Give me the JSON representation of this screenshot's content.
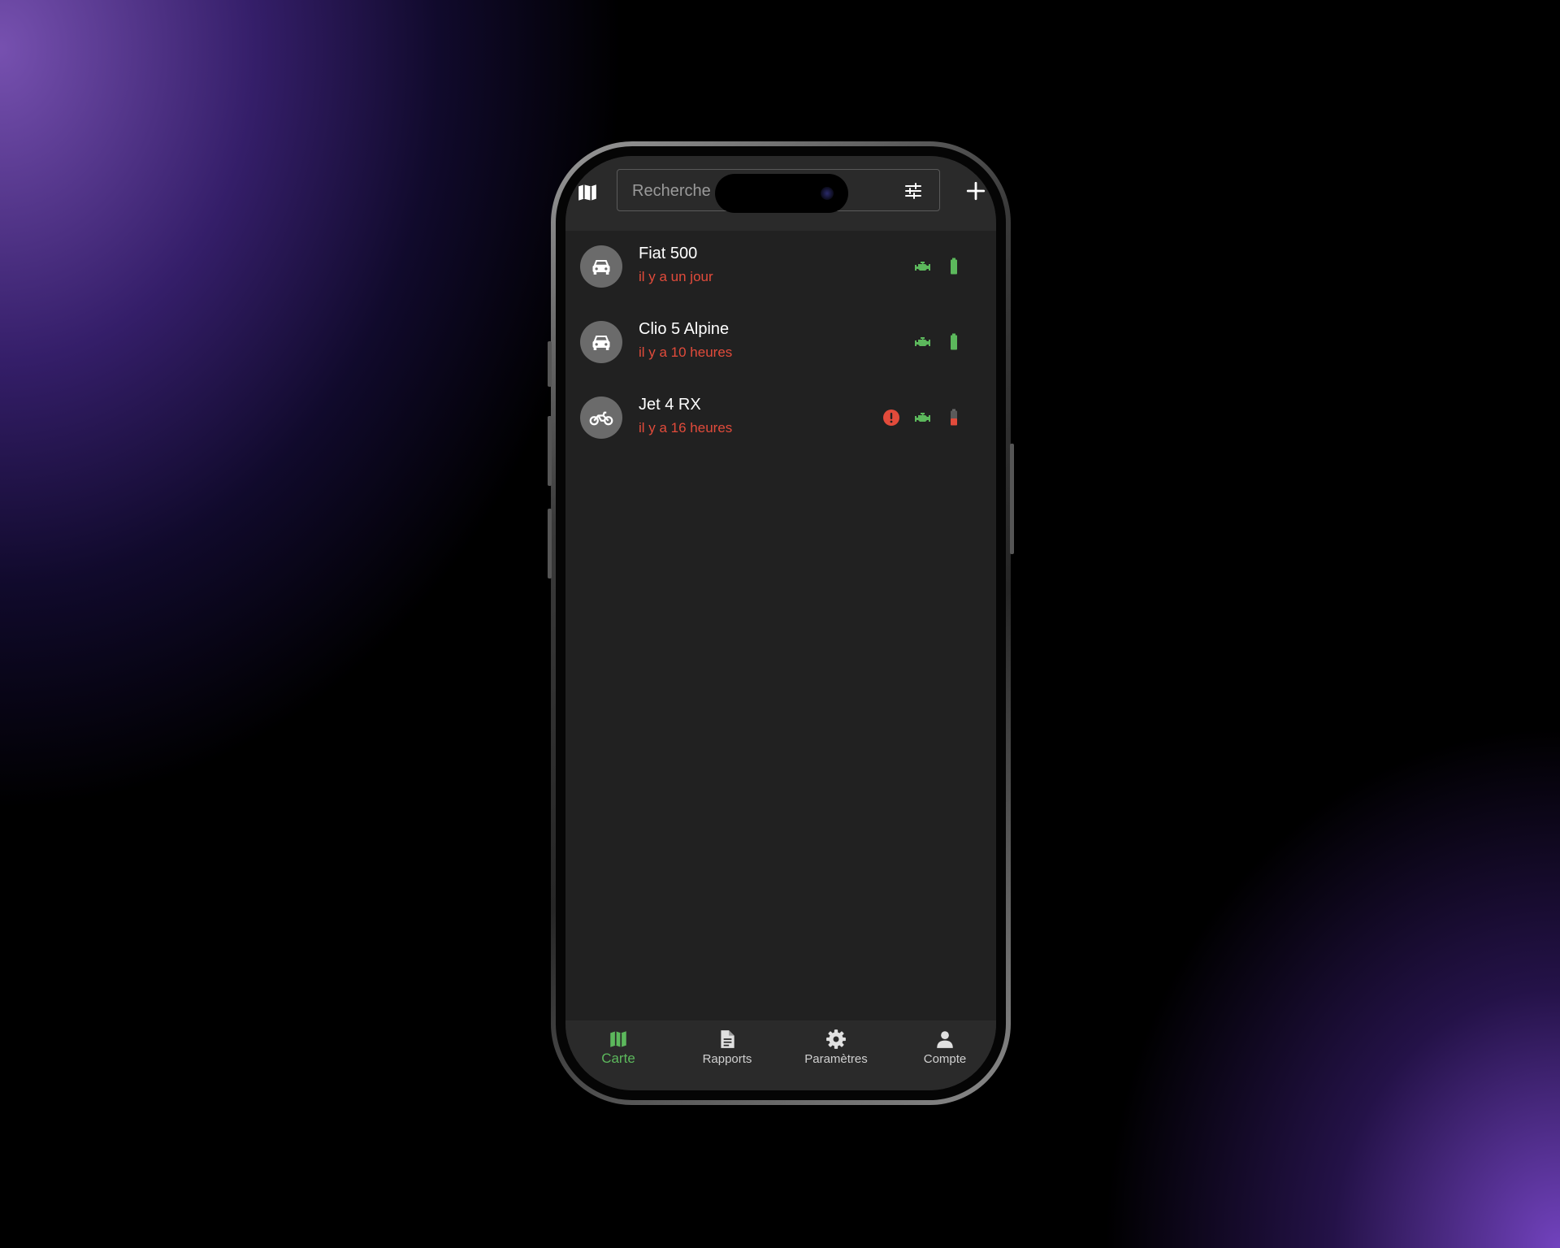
{
  "header": {
    "search_placeholder": "Recherche",
    "icons": {
      "map": "map-icon",
      "filter": "tune-icon",
      "add": "plus-icon"
    }
  },
  "vehicles": [
    {
      "name": "Fiat 500",
      "time": "il y a un jour",
      "type": "car-icon",
      "alert": false,
      "engine": "green",
      "battery": "full"
    },
    {
      "name": "Clio 5 Alpine",
      "time": "il y a 10 heures",
      "type": "car-icon",
      "alert": false,
      "engine": "green",
      "battery": "full"
    },
    {
      "name": "Jet 4 RX",
      "time": "il y a 16 heures",
      "type": "motorcycle-icon",
      "alert": true,
      "engine": "green",
      "battery": "low"
    }
  ],
  "tabs": [
    {
      "label": "Carte",
      "icon": "map-icon",
      "active": true
    },
    {
      "label": "Rapports",
      "icon": "document-icon",
      "active": false
    },
    {
      "label": "Paramètres",
      "icon": "gear-icon",
      "active": false
    },
    {
      "label": "Compte",
      "icon": "person-icon",
      "active": false
    }
  ],
  "colors": {
    "screen_bg": "#212121",
    "bar_bg": "#2a2a2a",
    "accent_green": "#5cb85c",
    "alert_red": "#e24b3b",
    "text": "#ffffff"
  }
}
